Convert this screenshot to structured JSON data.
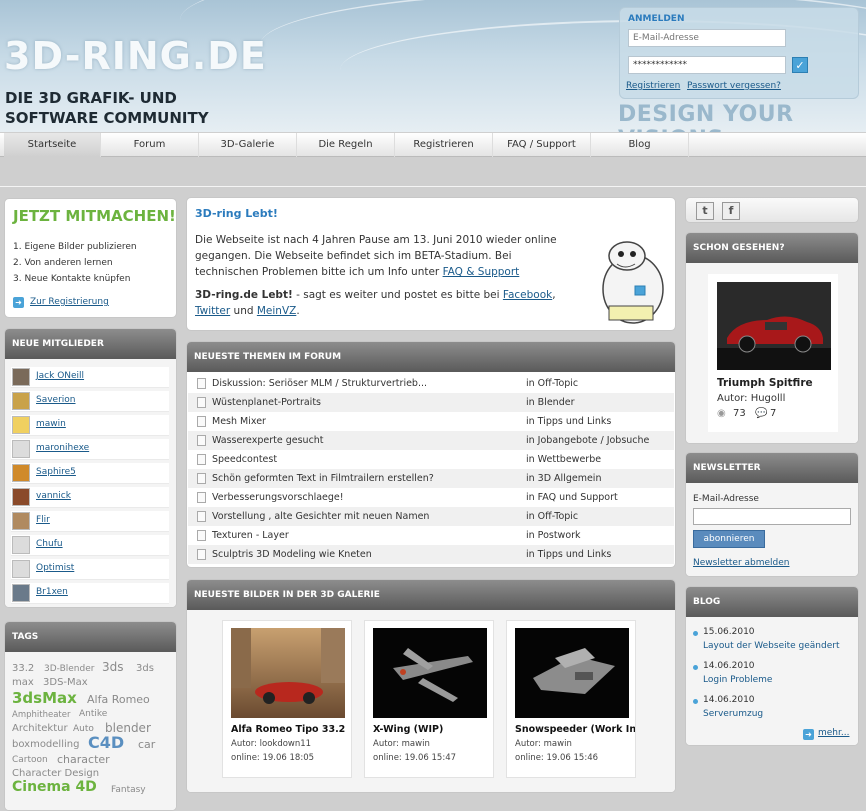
{
  "header": {
    "logo": "3D-RING.DE",
    "tagline_line1": "DIE 3D GRAFIK- UND",
    "tagline_line2": "SOFTWARE COMMUNITY",
    "slogan": "DESIGN YOUR VISIONS",
    "login": {
      "title": "ANMELDEN",
      "email_placeholder": "E-Mail-Adresse",
      "password_value": "************",
      "register_link": "Registrieren",
      "forgot_link": "Passwort vergessen?"
    }
  },
  "nav": {
    "items": [
      "Startseite",
      "Forum",
      "3D-Galerie",
      "Die Regeln",
      "Registrieren",
      "FAQ / Support",
      "Blog"
    ]
  },
  "left": {
    "jetzt": {
      "title": "JETZT MITMACHEN!",
      "items": [
        "1. Eigene Bilder publizieren",
        "2. Von anderen lernen",
        "3. Neue Kontakte knüpfen"
      ],
      "link": "Zur Registrierung"
    },
    "members": {
      "title": "NEUE MITGLIEDER",
      "items": [
        "Jack ONeill",
        "Saverion",
        "mawin",
        "maronihexe",
        "Saphire5",
        "vannick",
        "Flir",
        "Chufu",
        "Optimist",
        "Br1xen"
      ]
    },
    "tags": {
      "title": "TAGS",
      "items": [
        "33.2",
        "3D-Blender",
        "3ds",
        "3ds",
        "max",
        "3DS-Max",
        "3dsMax",
        "Alfa Romeo",
        "Amphitheater",
        "Antike",
        "Architektur",
        "Auto",
        "blender",
        "boxmodelling",
        "C4D",
        "car",
        "Cartoon",
        "character",
        "Character Design",
        "Cinema 4D",
        "Fantasy"
      ]
    }
  },
  "center": {
    "lebt": {
      "title": "3D-ring Lebt!",
      "para1": "Die Webseite ist nach 4 Jahren Pause am 13. Juni 2010 wieder online gegangen. Die Webseite befindet sich im BETA-Stadium. Bei technischen Problemen bitte ich um Info unter ",
      "faq_link": "FAQ & Support",
      "bold": "3D-ring.de Lebt!",
      "para2": " - sagt es weiter und postet es bitte bei ",
      "facebook": "Facebook",
      "comma": ",",
      "twitter": "Twitter",
      "und": " und ",
      "meinvz": "MeinVZ",
      "dot": "."
    },
    "forum": {
      "title": "NEUESTE THEMEN IM FORUM",
      "rows": [
        {
          "title": "Diskussion: Seriöser MLM / Strukturvertrieb...",
          "category": "in Off-Topic"
        },
        {
          "title": "Wüstenplanet-Portraits",
          "category": "in Blender"
        },
        {
          "title": "Mesh Mixer",
          "category": "in Tipps und Links"
        },
        {
          "title": "Wasserexperte gesucht",
          "category": "in Jobangebote / Jobsuche"
        },
        {
          "title": "Speedcontest",
          "category": "in Wettbewerbe"
        },
        {
          "title": "Schön geformten Text in Filmtrailern erstellen?",
          "category": "in 3D Allgemein"
        },
        {
          "title": "Verbesserungsvorschlaege!",
          "category": "in FAQ und Support"
        },
        {
          "title": "Vorstellung , alte Gesichter mit neuen Namen",
          "category": "in Off-Topic"
        },
        {
          "title": "Texturen - Layer",
          "category": "in Postwork"
        },
        {
          "title": "Sculptris 3D Modeling wie Kneten",
          "category": "in Tipps und Links"
        }
      ]
    },
    "gallery": {
      "title": "NEUESTE BILDER IN DER 3D GALERIE",
      "items": [
        {
          "name": "Alfa Romeo Tipo 33.2",
          "author": "Autor: lookdown11",
          "online": "online: 19.06 18:05"
        },
        {
          "name": "X-Wing (WIP)",
          "author": "Autor: mawin",
          "online": "online: 19.06 15:47"
        },
        {
          "name": "Snowspeeder (Work In",
          "author": "Autor: mawin",
          "online": "online: 19.06 15:46"
        }
      ]
    }
  },
  "right": {
    "gesehen": {
      "title": "SCHON GESEHEN?",
      "name": "Triumph Spitfire",
      "author": "Autor: Hugolll",
      "views": "73",
      "comments": "7"
    },
    "newsletter": {
      "title": "NEWSLETTER",
      "label": "E-Mail-Adresse",
      "button": "abonnieren",
      "unsubscribe": "Newsletter abmelden"
    },
    "blog": {
      "title": "BLOG",
      "items": [
        {
          "date": "15.06.2010",
          "title": "Layout der Webseite geändert"
        },
        {
          "date": "14.06.2010",
          "title": "Login Probleme"
        },
        {
          "date": "14.06.2010",
          "title": "Serverumzug"
        }
      ],
      "more": "mehr..."
    }
  }
}
